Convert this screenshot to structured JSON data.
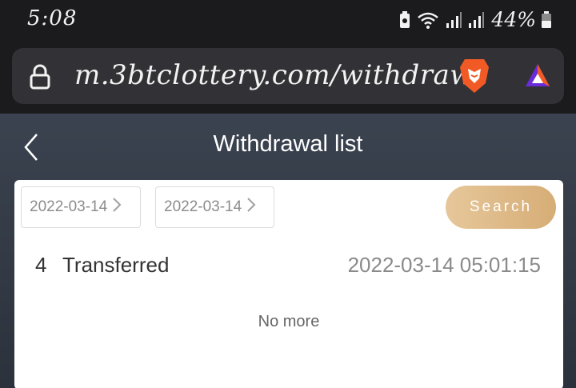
{
  "status_bar": {
    "time": "5:08",
    "battery": "44%",
    "icons": [
      "battery-saver-icon",
      "wifi-icon",
      "signal-icon",
      "signal-icon",
      "battery-icon"
    ]
  },
  "browser": {
    "url": "m.3btclottery.com/withdraw",
    "icons": [
      "lock-icon",
      "brave-lion-icon",
      "brave-rewards-icon"
    ]
  },
  "page": {
    "title": "Withdrawal list",
    "back_icon": "chevron-left-icon"
  },
  "filters": {
    "date_from": "2022-03-14",
    "date_to": "2022-03-14",
    "search_label": "Search"
  },
  "records": [
    {
      "id": "4",
      "status": "Transferred",
      "time": "2022-03-14 05:01:15"
    }
  ],
  "footer_text": "No more",
  "colors": {
    "search_gradient_start": "#e6c79a",
    "search_gradient_end": "#d6ad76",
    "header_bg": "#3b4350",
    "browser_bg": "#1b1b1d",
    "address_bar_bg": "#323236"
  }
}
